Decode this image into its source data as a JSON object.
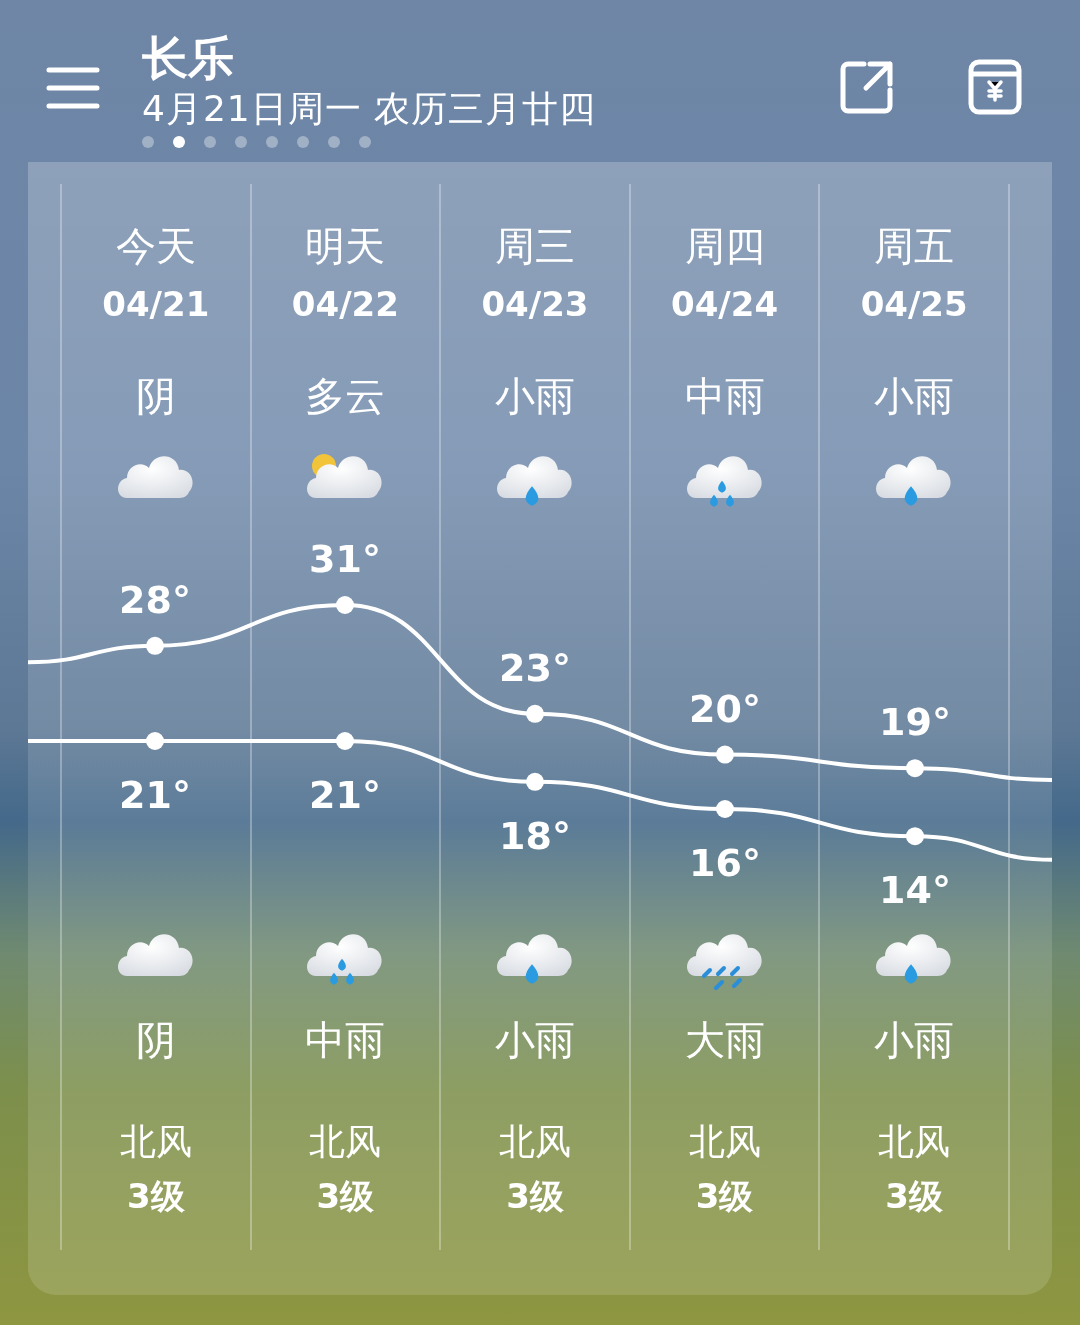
{
  "header": {
    "city": "长乐",
    "date": "4月21日周一 农历三月廿四",
    "pages": [
      {
        "selected": false
      },
      {
        "selected": true
      },
      {
        "selected": false
      },
      {
        "selected": false
      },
      {
        "selected": false
      },
      {
        "selected": false
      },
      {
        "selected": false
      },
      {
        "selected": false
      }
    ]
  },
  "days": [
    {
      "name": "今天",
      "date": "04/21",
      "day": {
        "condition": "阴",
        "kind": "overcast"
      },
      "high": "28°",
      "low": "21°",
      "night": {
        "condition": "阴",
        "kind": "overcast"
      },
      "wind": "北风",
      "wind_level": "3级"
    },
    {
      "name": "明天",
      "date": "04/22",
      "day": {
        "condition": "多云",
        "kind": "partly_cloudy"
      },
      "high": "31°",
      "low": "21°",
      "night": {
        "condition": "中雨",
        "kind": "moderate_rain"
      },
      "wind": "北风",
      "wind_level": "3级"
    },
    {
      "name": "周三",
      "date": "04/23",
      "day": {
        "condition": "小雨",
        "kind": "light_rain"
      },
      "high": "23°",
      "low": "18°",
      "night": {
        "condition": "小雨",
        "kind": "light_rain"
      },
      "wind": "北风",
      "wind_level": "3级"
    },
    {
      "name": "周四",
      "date": "04/24",
      "day": {
        "condition": "中雨",
        "kind": "moderate_rain"
      },
      "high": "20°",
      "low": "16°",
      "night": {
        "condition": "大雨",
        "kind": "heavy_rain"
      },
      "wind": "北风",
      "wind_level": "3级"
    },
    {
      "name": "周五",
      "date": "04/25",
      "day": {
        "condition": "小雨",
        "kind": "light_rain"
      },
      "high": "19°",
      "low": "14°",
      "night": {
        "condition": "小雨",
        "kind": "light_rain"
      },
      "wind": "北风",
      "wind_level": "3级"
    }
  ]
}
